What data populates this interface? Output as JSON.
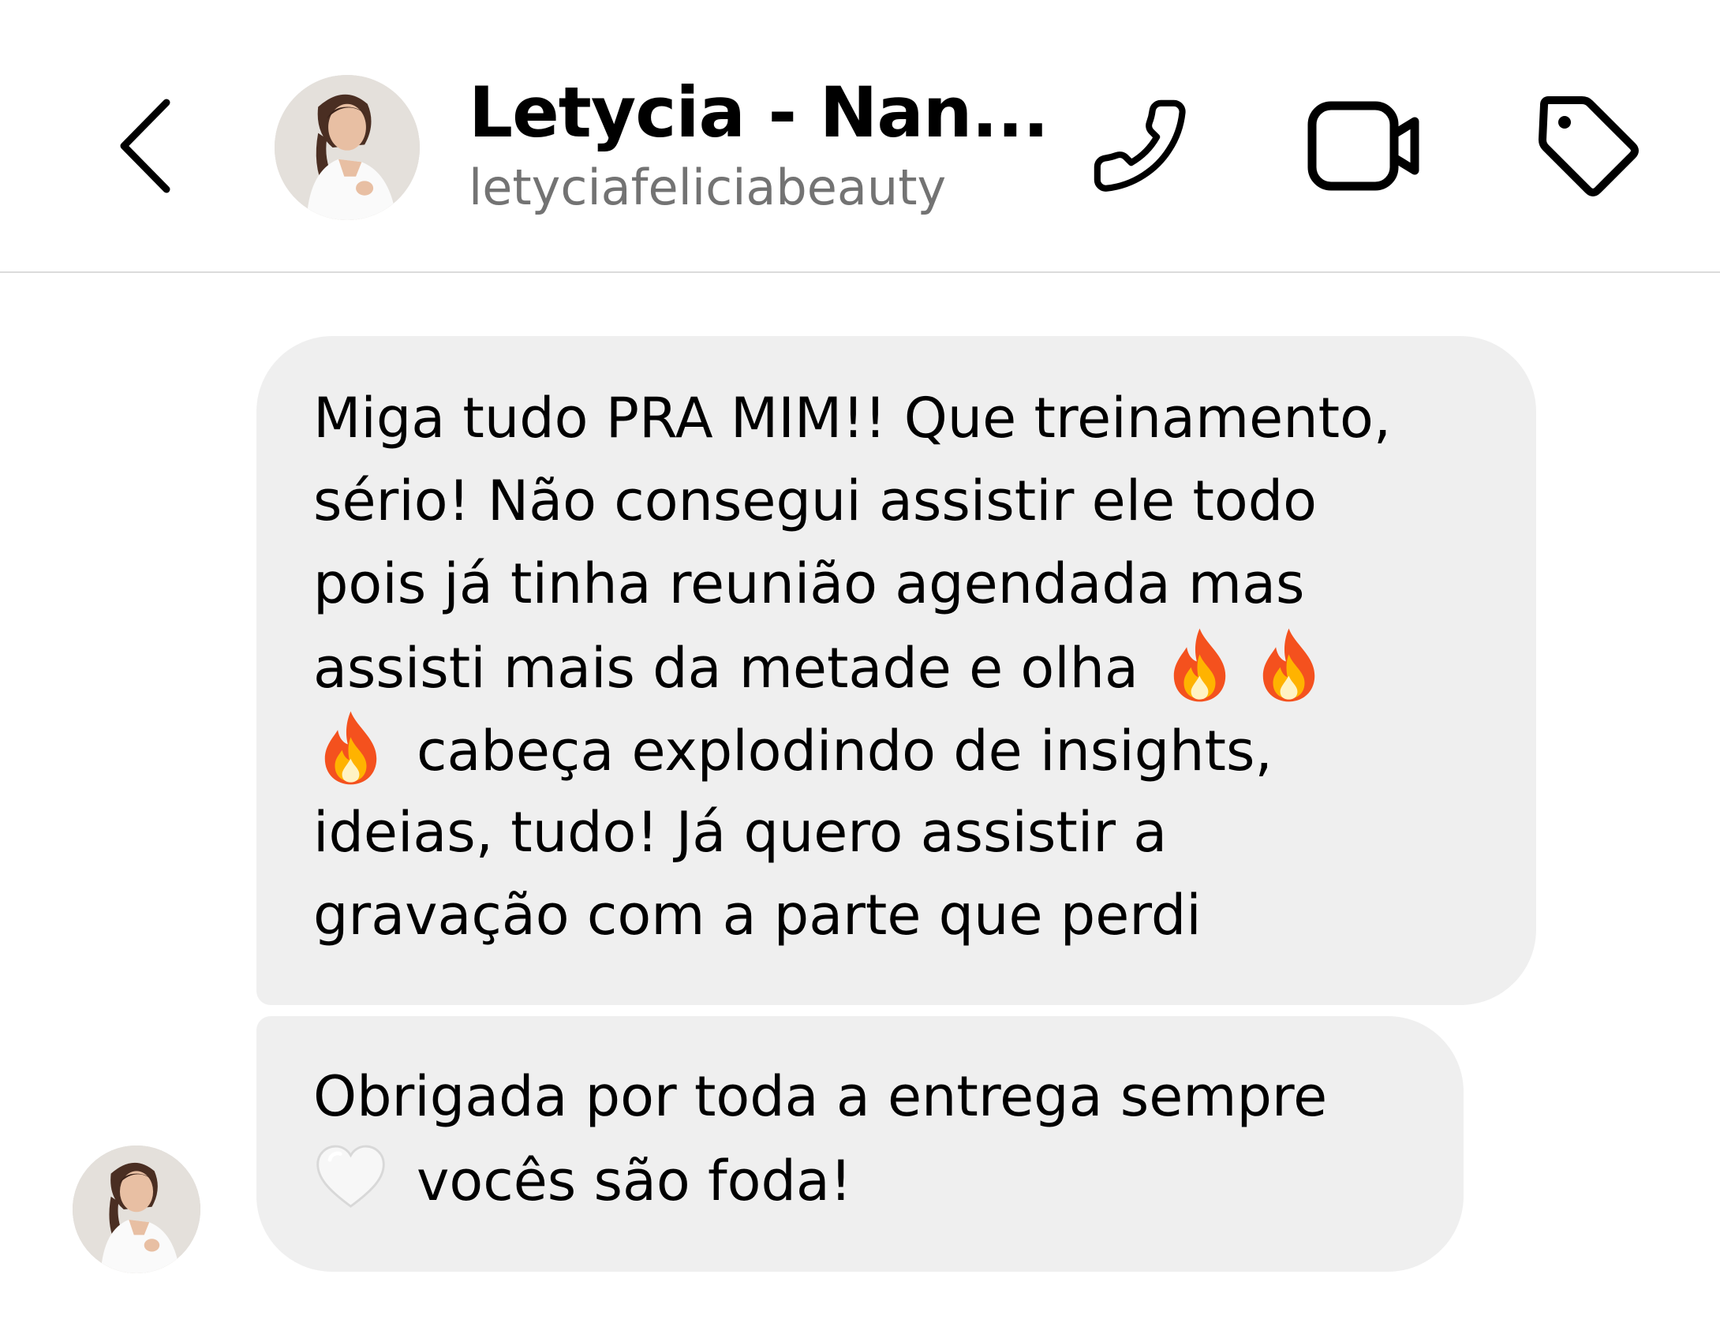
{
  "header": {
    "contact_name": "Letycia - Nan...",
    "contact_handle": "letyciafeliciabeauty",
    "back_icon": "chevron-left-icon",
    "actions": [
      {
        "name": "call",
        "icon": "phone-icon"
      },
      {
        "name": "video-call",
        "icon": "video-camera-icon"
      },
      {
        "name": "label",
        "icon": "tag-icon"
      }
    ]
  },
  "messages": [
    {
      "lines": [
        "Miga tudo PRA MIM!! Que treinamento,",
        "sério! Não consegui assistir ele todo",
        "pois já tinha reunião agendada mas",
        "assisti mais da metade e olha",
        "cabeça explodindo de insights,",
        "ideias, tudo! Já quero assistir a",
        "gravação com a parte que perdi"
      ],
      "emojis": [
        "fire-emoji",
        "fire-emoji",
        "fire-emoji"
      ]
    },
    {
      "lines": [
        "Obrigada por toda a entrega sempre",
        "vocês são foda!"
      ],
      "emojis": [
        "white-heart-emoji"
      ]
    }
  ],
  "colors": {
    "bubble_background": "#efefef",
    "handle_text": "#737373",
    "divider": "#dbdbdb",
    "text": "#000000"
  }
}
